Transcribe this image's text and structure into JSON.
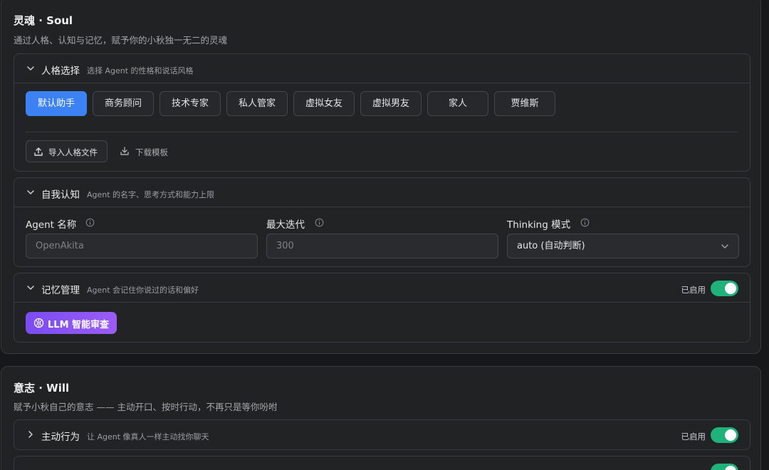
{
  "soul": {
    "title": "灵魂 · Soul",
    "subtitle": "通过人格、认知与记忆，赋予你的小秋独一无二的灵魂",
    "persona": {
      "title": "人格选择",
      "desc": "选择 Agent 的性格和说话风格",
      "options": [
        "默认助手",
        "商务顾问",
        "技术专家",
        "私人管家",
        "虚拟女友",
        "虚拟男友",
        "家人",
        "贾维斯"
      ],
      "selected": "默认助手",
      "import_label": "导入人格文件",
      "download_label": "下载模板"
    },
    "cognition": {
      "title": "自我认知",
      "desc": "Agent 的名字、思考方式和能力上限",
      "name_label": "Agent 名称",
      "name_placeholder": "OpenAkita",
      "iter_label": "最大迭代",
      "iter_placeholder": "300",
      "thinking_label": "Thinking 模式",
      "thinking_value": "auto (自动判断)"
    },
    "memory": {
      "title": "记忆管理",
      "desc": "Agent 会记住你说过的话和偏好",
      "status": "已启用",
      "enabled": true,
      "llm_button": "LLM 智能审查"
    }
  },
  "will": {
    "title": "意志 · Will",
    "subtitle": "赋予小秋自己的意志 —— 主动开口、按时行动，不再只是等你吩咐",
    "proactive": {
      "title": "主动行为",
      "desc": "让 Agent 像真人一样主动找你聊天",
      "status": "已启用",
      "enabled": true
    }
  },
  "colors": {
    "accent": "#3d82f5",
    "toggle_on": "#1fb27a",
    "llm_gradient_start": "#7b4cf2",
    "llm_gradient_end": "#9b5cf5",
    "card_bg": "#212224",
    "page_bg": "#17181a"
  }
}
